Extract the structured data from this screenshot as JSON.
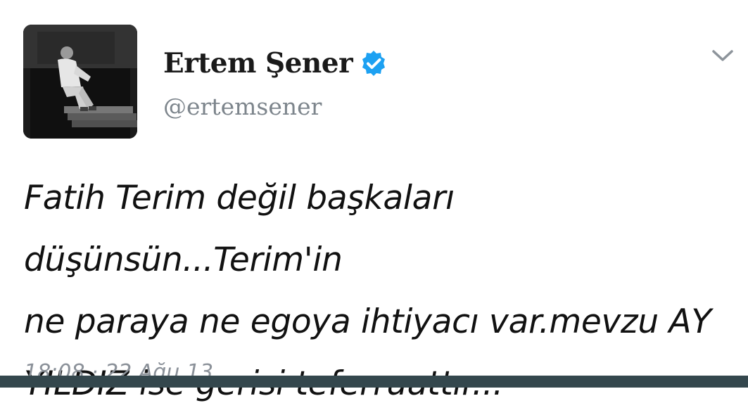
{
  "profile": {
    "display_name": "Ertem Şener",
    "handle": "@ertemsener",
    "verified": true,
    "avatar_icon": "profile-photo"
  },
  "tweet": {
    "line_1": "Fatih Terim değil başkaları düşünsün...Terim'in",
    "line_2": "ne paraya ne egoya ihtiyacı var.mevzu AY",
    "line_3": "YILDIZ  ise gerisi teferruattır...",
    "timestamp": "18:08 · 22 Ağu 13"
  },
  "controls": {
    "menu_icon": "chevron-down-icon"
  },
  "colors": {
    "verified_blue": "#1da1f2",
    "handle_gray": "#7d858c",
    "bottom_bar": "#34474d"
  }
}
